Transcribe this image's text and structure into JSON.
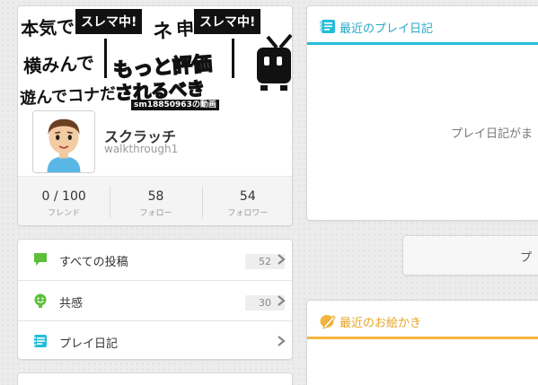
{
  "profile": {
    "banner": {
      "handwritten_lines": [
        "本気で",
        "横みんで",
        "遊んでコナだ"
      ],
      "signs": [
        "スレマ中!",
        "スレマ中!"
      ],
      "middle_text": [
        "ネ",
        "申"
      ],
      "big_text_1": "もっと評価",
      "big_text_2": "されるべき",
      "caption": "sm18850963の動画",
      "icon": "niconico-tv-icon"
    },
    "avatar_icon": "mii-avatar",
    "display_name": "スクラッチ",
    "user_id": "walkthrough1",
    "stats": [
      {
        "value": "0 / 100",
        "label": "フレンド"
      },
      {
        "value": "58",
        "label": "フォロー"
      },
      {
        "value": "54",
        "label": "フォロワー"
      }
    ]
  },
  "menu": {
    "items": [
      {
        "label": "すべての投稿",
        "count": "52",
        "icon": "speech-bubble-icon",
        "color": "#5bbf3a"
      },
      {
        "label": "共感",
        "count": "30",
        "icon": "smiley-icon",
        "color": "#5bbf3a"
      },
      {
        "label": "プレイ日記",
        "count": "",
        "icon": "diary-icon",
        "color": "#25bcd9"
      }
    ]
  },
  "diary_card": {
    "title": "最近のプレイ日記",
    "empty_text": "プレイ日記がま",
    "accent": "#25bcd9"
  },
  "more_button": {
    "label": "プ"
  },
  "drawing_card": {
    "title": "最近のお絵かき",
    "accent": "#f3b53d"
  }
}
